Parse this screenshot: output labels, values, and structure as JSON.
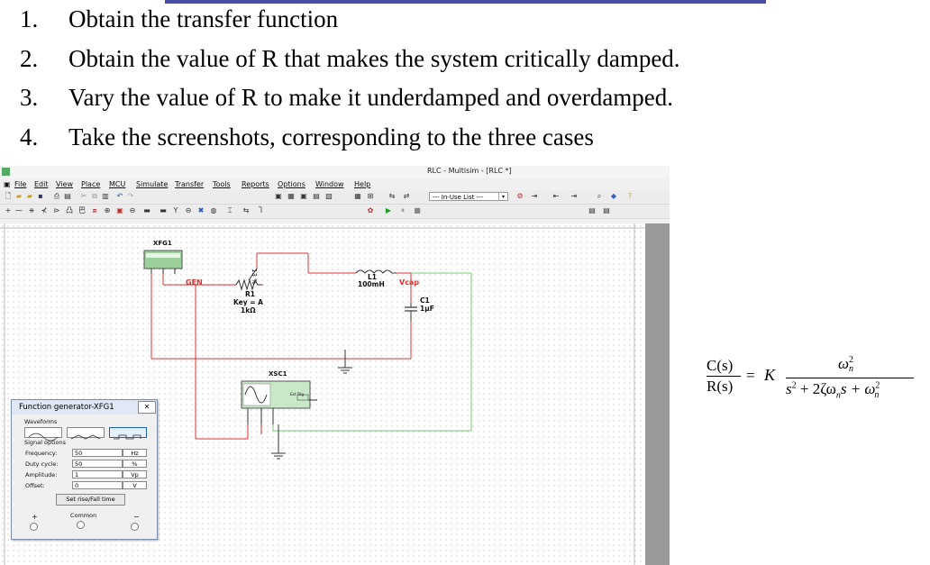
{
  "list": [
    {
      "num": "1.",
      "text": "Obtain the transfer function"
    },
    {
      "num": "2.",
      "text": "Obtain the value of R that makes the system critically damped."
    },
    {
      "num": "3.",
      "text": "Vary the value of R to make it underdamped and overdamped."
    },
    {
      "num": "4.",
      "text": "Take the screenshots, corresponding to the three cases"
    }
  ],
  "app": {
    "title": "RLC - Multisim - [RLC *]",
    "menu": [
      "File",
      "Edit",
      "View",
      "Place",
      "MCU",
      "Simulate",
      "Transfer",
      "Tools",
      "Reports",
      "Options",
      "Window",
      "Help"
    ],
    "inuse_list": "--- In-Use List ---"
  },
  "schematic": {
    "xfg1": "XFG1",
    "gen": "GEN",
    "r1_name": "R1",
    "r1_key": "Key = A",
    "r1_value": "1kΩ",
    "r1_pct": "13 %",
    "l1_name": "L1",
    "l1_value": "100mH",
    "vcap": "Vcap",
    "c1_name": "C1",
    "c1_value": "1µF",
    "xsc1": "XSC1",
    "ext_trig": "Ext Trig"
  },
  "dialog": {
    "title": "Function generator-XFG1",
    "close": "✕",
    "waveforms": "Waveforms",
    "signal_options": "Signal options",
    "frequency_label": "Frequency:",
    "frequency_value": "50",
    "frequency_unit": "Hz",
    "duty_label": "Duty cycle:",
    "duty_value": "50",
    "duty_unit": "%",
    "amplitude_label": "Amplitude:",
    "amplitude_value": "1",
    "amplitude_unit": "Vp",
    "offset_label": "Offset:",
    "offset_value": "0",
    "offset_unit": "V",
    "rise_fall_button": "Set rise/Fall time",
    "plus": "+",
    "common": "Common",
    "minus": "−"
  },
  "formula": {
    "lhs_num": "C(s)",
    "lhs_den": "R(s)",
    "eq": "=",
    "gain": "K",
    "num": "ω",
    "num_sub": "n",
    "num_sup": "2",
    "den_s": "s",
    "den_sup": "2",
    "den_mid": " + 2ζω",
    "den_mid_sub": "n",
    "den_s2": "s + ω",
    "den_end_sub": "n",
    "den_end_sup": "2"
  },
  "colors": {
    "wire_red": "#e03030",
    "wire_green": "#6fcf6f",
    "vcap_red": "#e03030",
    "canvas_bg": "#ffffff",
    "scrollbar": "#9a9a9a"
  }
}
